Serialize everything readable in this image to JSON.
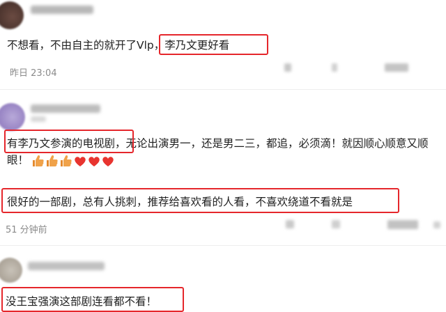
{
  "comments": [
    {
      "text_before_highlight": "不想看，不由自主的就开了Vlp，",
      "highlight": "李乃文更好看",
      "time": "昨日 23:04"
    },
    {
      "highlight": "有李乃文参演的电视剧，",
      "line1_rest": "无论出演男一，还是男二三，都追，必须滴！就因顺心顺意又顺",
      "line2": "眼！",
      "emoji_names": [
        "thumbs-up-icon",
        "thumbs-up-icon",
        "thumbs-up-icon",
        "red-heart-icon",
        "red-heart-icon",
        "red-heart-icon"
      ]
    },
    {
      "text": "很好的一部剧，总有人挑刺，推荐给喜欢看的人看，不喜欢绕道不看就是",
      "time": "51 分钟前"
    },
    {
      "text": "没王宝强演这部剧连看都不看！"
    }
  ],
  "colors": {
    "highlight_box": "#e5262b",
    "meta_text": "#8a8a8a",
    "thumbs": "#f0a24a",
    "heart": "#e8342f"
  }
}
